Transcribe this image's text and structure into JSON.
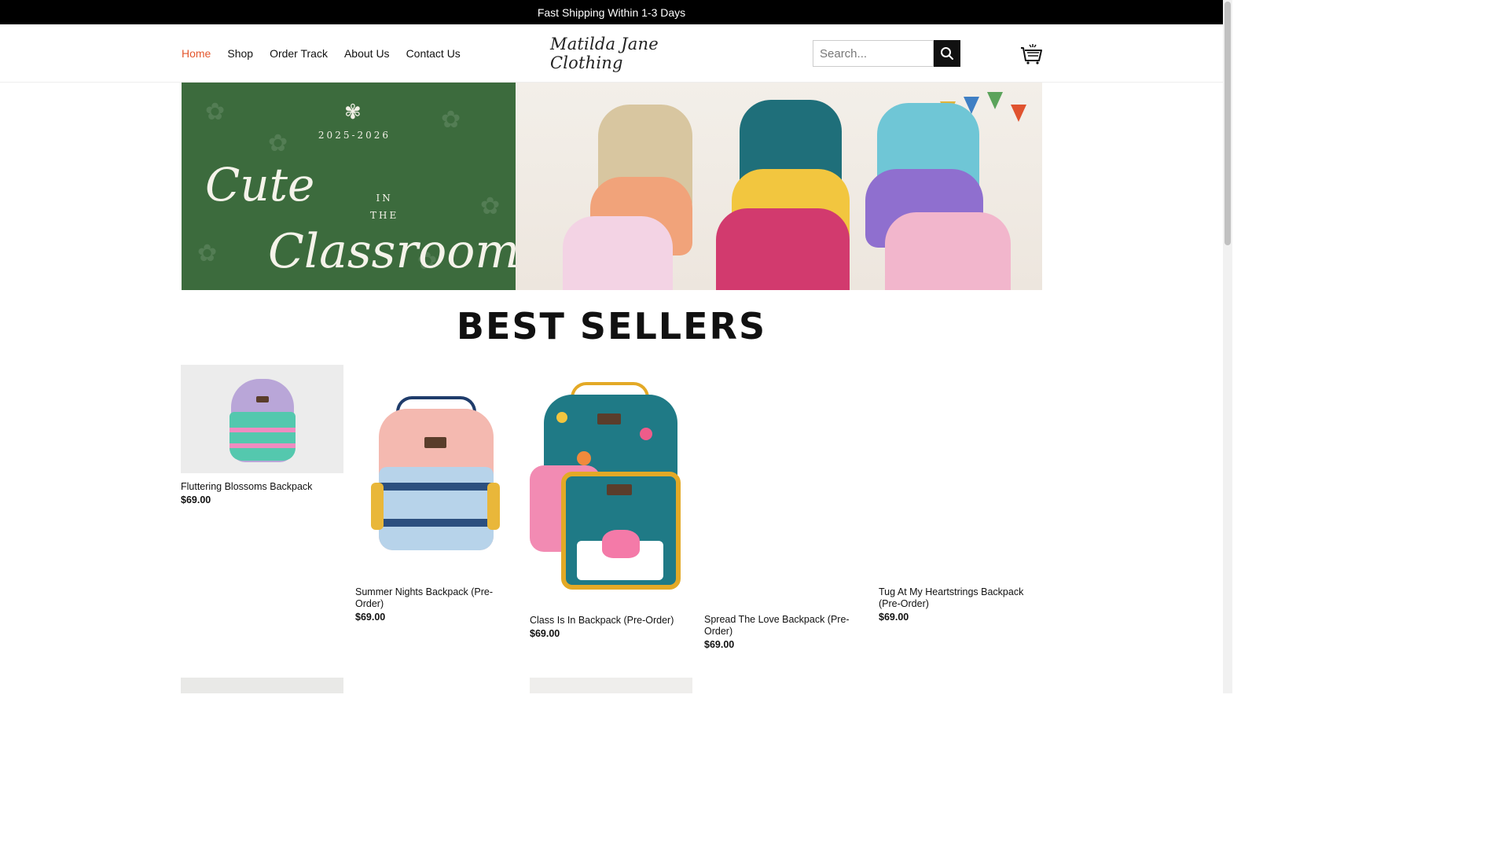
{
  "announcement": "Fast Shipping Within 1-3 Days",
  "nav": {
    "items": [
      {
        "label": "Home",
        "active": true
      },
      {
        "label": "Shop",
        "active": false
      },
      {
        "label": "Order Track",
        "active": false
      },
      {
        "label": "About Us",
        "active": false
      },
      {
        "label": "Contact Us",
        "active": false
      }
    ]
  },
  "logo": {
    "text": "Matilda Jane Clothing"
  },
  "search": {
    "placeholder": "Search..."
  },
  "hero": {
    "year": "2025-2026",
    "line1": "Cute",
    "line_mid": "IN\nTHE",
    "line2": "Classroom"
  },
  "best_sellers": {
    "title": "BEST SELLERS",
    "products": [
      {
        "name": "Fluttering Blossoms Backpack",
        "price": "$69.00"
      },
      {
        "name": "Summer Nights Backpack (Pre-Order)",
        "price": "$69.00"
      },
      {
        "name": "Class Is In Backpack (Pre-Order)",
        "price": "$69.00"
      },
      {
        "name": "Spread The Love Backpack (Pre-Order)",
        "price": "$69.00"
      },
      {
        "name": "Tug At My Heartstrings Backpack (Pre-Order)",
        "price": "$69.00"
      }
    ]
  },
  "colors": {
    "accent": "#e4572e",
    "topbar_bg": "#000000",
    "hero_green": "#3c6b3d"
  }
}
